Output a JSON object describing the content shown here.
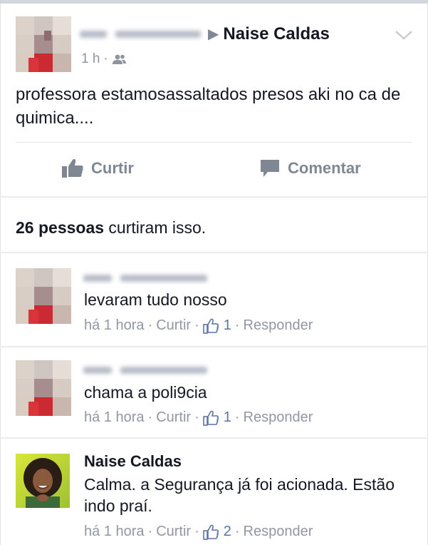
{
  "post": {
    "author_name_blurred": "Ingrid Lorrana",
    "target_name": "Naise Caldas",
    "time": "1 h",
    "privacy_icon": "friends-icon",
    "text": "professora estamosassaltados presos aki no ca de quimica....",
    "actions": {
      "like_label": "Curtir",
      "comment_label": "Comentar"
    },
    "likes_summary": {
      "count_text": "26 pessoas",
      "suffix": "curtiram isso."
    }
  },
  "comments": [
    {
      "author_blurred": "Ingrid Lorrana",
      "text": "levaram tudo nosso",
      "time": "há 1 hora",
      "like_label": "Curtir",
      "likes": "1",
      "reply_label": "Responder"
    },
    {
      "author_blurred": "Ingrid Lorrana",
      "text": "chama a poli9cia",
      "time": "há 1 hora",
      "like_label": "Curtir",
      "likes": "1",
      "reply_label": "Responder"
    },
    {
      "author": "Naise Caldas",
      "text": "Calma. a Segurança já foi acionada. Estão indo praí.",
      "time": "há 1 hora",
      "like_label": "Curtir",
      "likes": "2",
      "reply_label": "Responder"
    }
  ],
  "colors": {
    "text": "#141823",
    "meta": "#9197a3",
    "like_blue": "#5b74a8",
    "divider": "#e9ebee"
  }
}
